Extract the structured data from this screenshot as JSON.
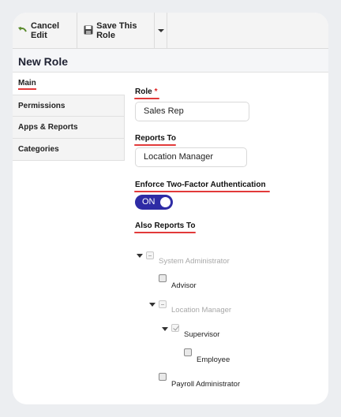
{
  "toolbar": {
    "cancel_label": "Cancel Edit",
    "save_label": "Save This Role"
  },
  "page_title": "New Role",
  "nav": {
    "items": [
      {
        "label": "Main",
        "active": true
      },
      {
        "label": "Permissions",
        "active": false
      },
      {
        "label": "Apps & Reports",
        "active": false
      },
      {
        "label": "Categories",
        "active": false
      }
    ]
  },
  "form": {
    "role_label": "Role",
    "role_required_mark": "*",
    "role_value": "Sales Rep",
    "reports_to_label": "Reports To",
    "reports_to_value": "Location Manager",
    "two_factor_label": "Enforce Two-Factor Authentication",
    "two_factor_state": "ON",
    "also_reports_to_label": "Also Reports To"
  },
  "tree": {
    "items": [
      {
        "label": "System Administrator",
        "state": "partial",
        "expanded": true,
        "disabled": true
      },
      {
        "label": "Advisor",
        "state": "unchecked"
      },
      {
        "label": "Location Manager",
        "state": "partial",
        "expanded": true,
        "disabled": true
      },
      {
        "label": "Supervisor",
        "state": "checked",
        "expanded": true
      },
      {
        "label": "Employee",
        "state": "unchecked"
      },
      {
        "label": "Payroll Administrator",
        "state": "unchecked"
      }
    ]
  },
  "colors": {
    "accent": "#2e2ba5",
    "underline": "#e23a3a",
    "required": "#dd2222"
  }
}
